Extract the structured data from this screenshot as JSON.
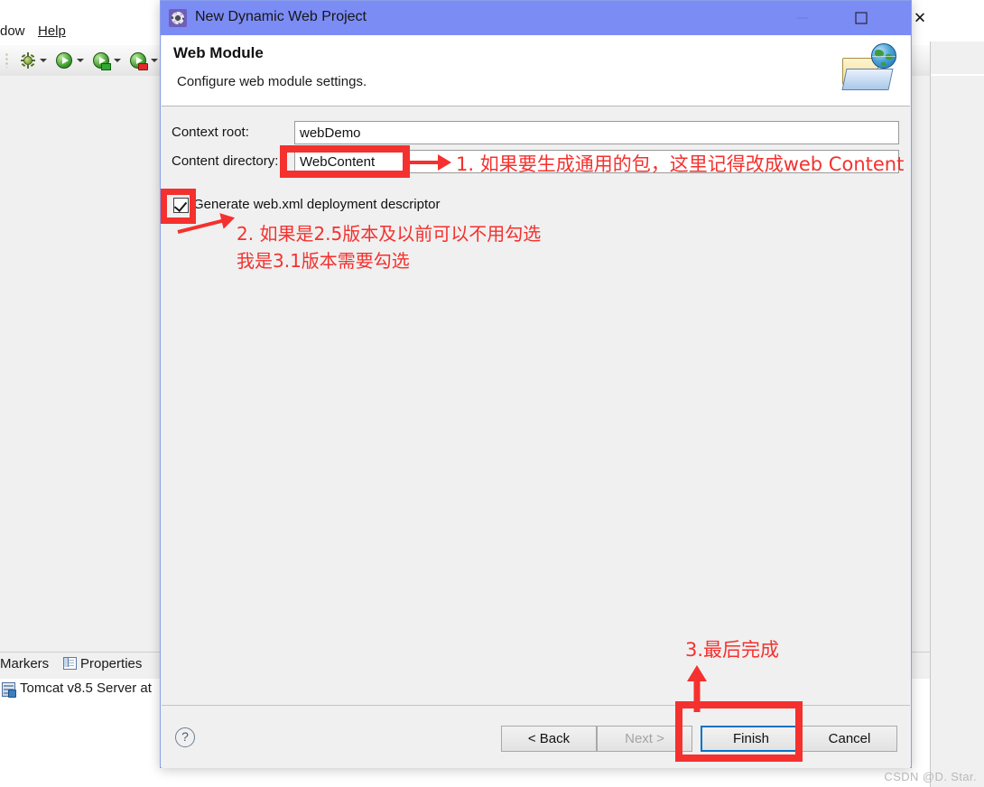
{
  "ide": {
    "menus": [
      {
        "label": "dow",
        "name": "menu-window-partial"
      },
      {
        "label": "Help",
        "name": "menu-help"
      }
    ],
    "menu_window_label": "dow",
    "menu_help_label": "Help",
    "toolbar_icons": [
      "debug-bug-icon",
      "run-icon",
      "run-server-icon",
      "run-external-tools-icon"
    ],
    "bottom_tabs": {
      "markers_label": "Markers",
      "properties_label": "Properties",
      "overflow_label": "»"
    },
    "server_row_label": "Tomcat v8.5 Server at"
  },
  "dialog": {
    "title": "New Dynamic Web Project",
    "window_buttons": {
      "minimize": "minimize-button",
      "maximize": "maximize-button",
      "close": "✕"
    },
    "header": {
      "title": "Web Module",
      "subtitle": "Configure web module settings."
    },
    "fields": [
      {
        "label": "Context root:",
        "value": "webDemo",
        "placeholder": "",
        "name": "context-root"
      },
      {
        "label": "Content directory:",
        "value": "WebContent",
        "placeholder": "",
        "name": "content-directory"
      }
    ],
    "checkbox": {
      "label": "Generate web.xml deployment descriptor",
      "checked": true
    },
    "footer": {
      "help_label": "?",
      "back_label": "< Back",
      "next_label": "Next >",
      "finish_label": "Finish",
      "cancel_label": "Cancel",
      "next_disabled": true,
      "finish_focused": true
    }
  },
  "annotations": {
    "accent_color": "#f4312e",
    "focus_color": "#0a72c4",
    "note1": "1. 如果要生成通用的包，这里记得改成web Content",
    "note2": "2. 如果是2.5版本及以前可以不用勾选",
    "note3": "我是3.1版本需要勾选",
    "note4": "3.最后完成"
  },
  "watermark": "CSDN @D. Star."
}
